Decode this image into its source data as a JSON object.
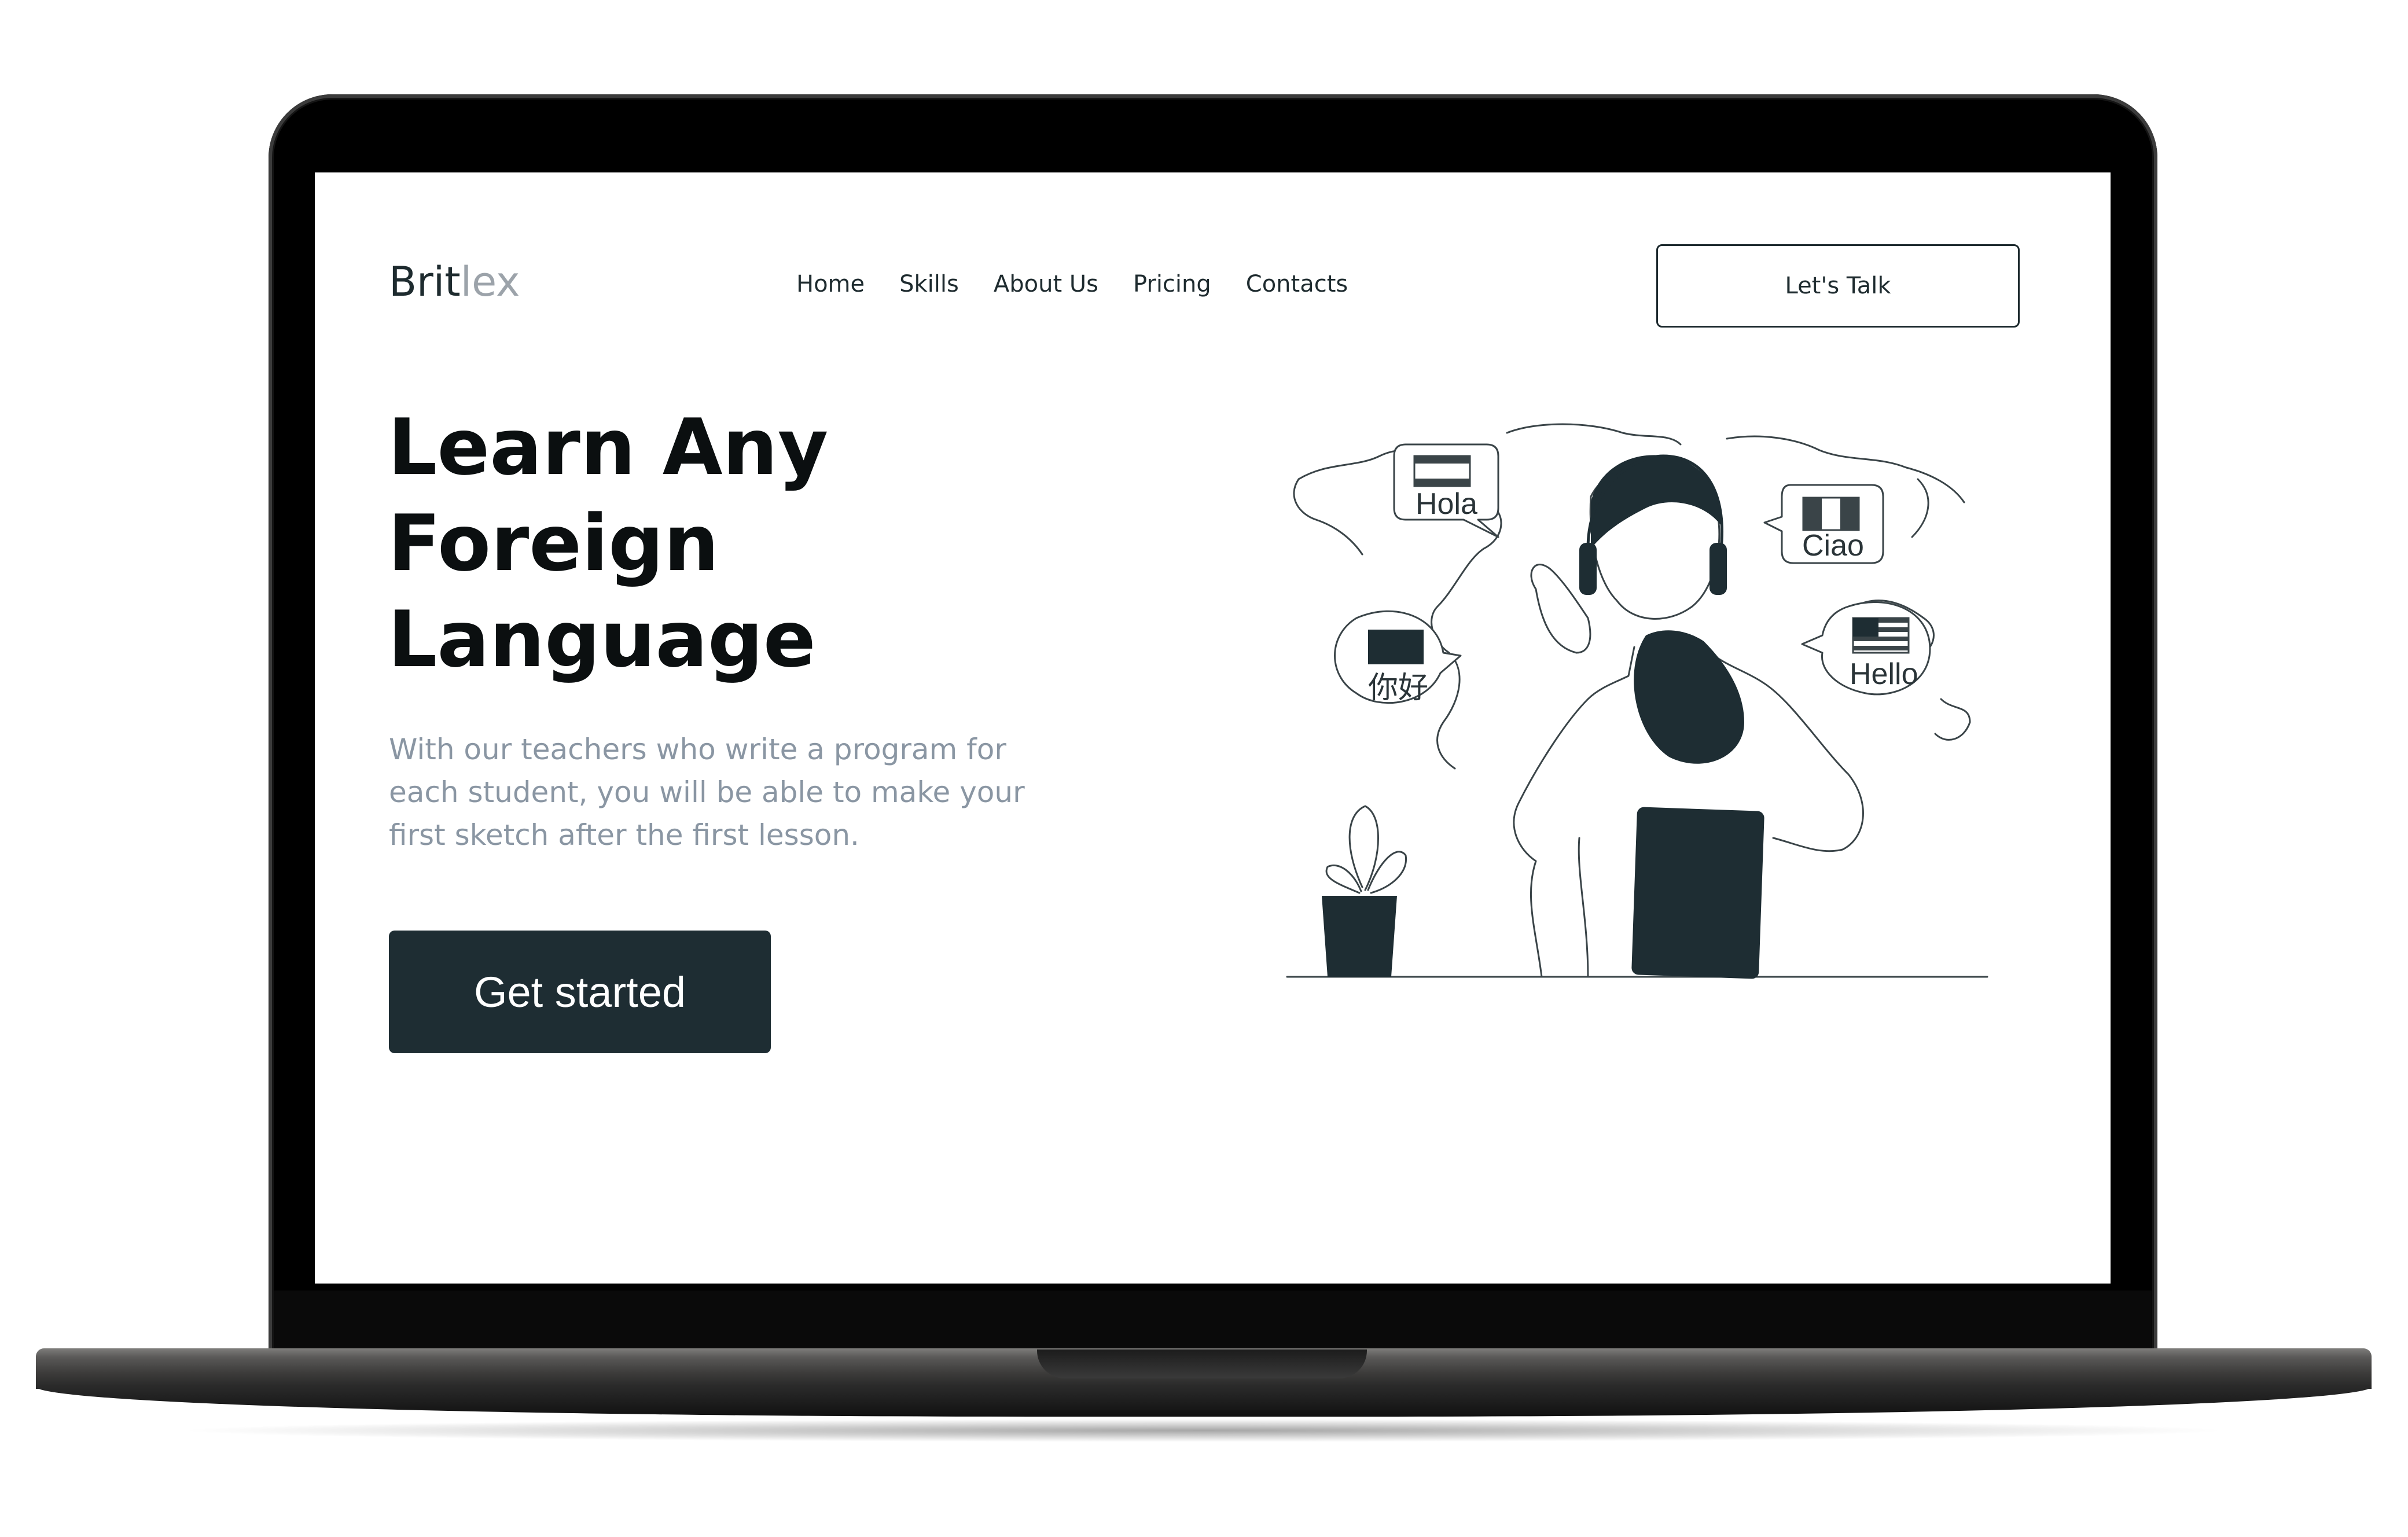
{
  "header": {
    "logo_primary": "Brit",
    "logo_secondary": "lex",
    "nav": [
      {
        "label": "Home"
      },
      {
        "label": "Skills"
      },
      {
        "label": "About Us"
      },
      {
        "label": "Pricing"
      },
      {
        "label": "Contacts"
      }
    ],
    "cta_label": "Let's Talk"
  },
  "hero": {
    "title_lines": [
      "Learn Any",
      "Foreign",
      "Language"
    ],
    "description_lines": [
      "With our teachers who write a program for",
      "each student, you will be able to make your",
      "first sketch after the first lesson."
    ],
    "button_label": "Get started"
  },
  "illustration": {
    "bubbles": [
      "Hola",
      "Ciao",
      "你好",
      "Hello"
    ],
    "accent_color": "#1e2d33",
    "line_color": "#3a4448"
  },
  "colors": {
    "dark": "#1e2d33",
    "muted_text": "#8a96a3",
    "logo_suffix": "#9ca3aa"
  }
}
